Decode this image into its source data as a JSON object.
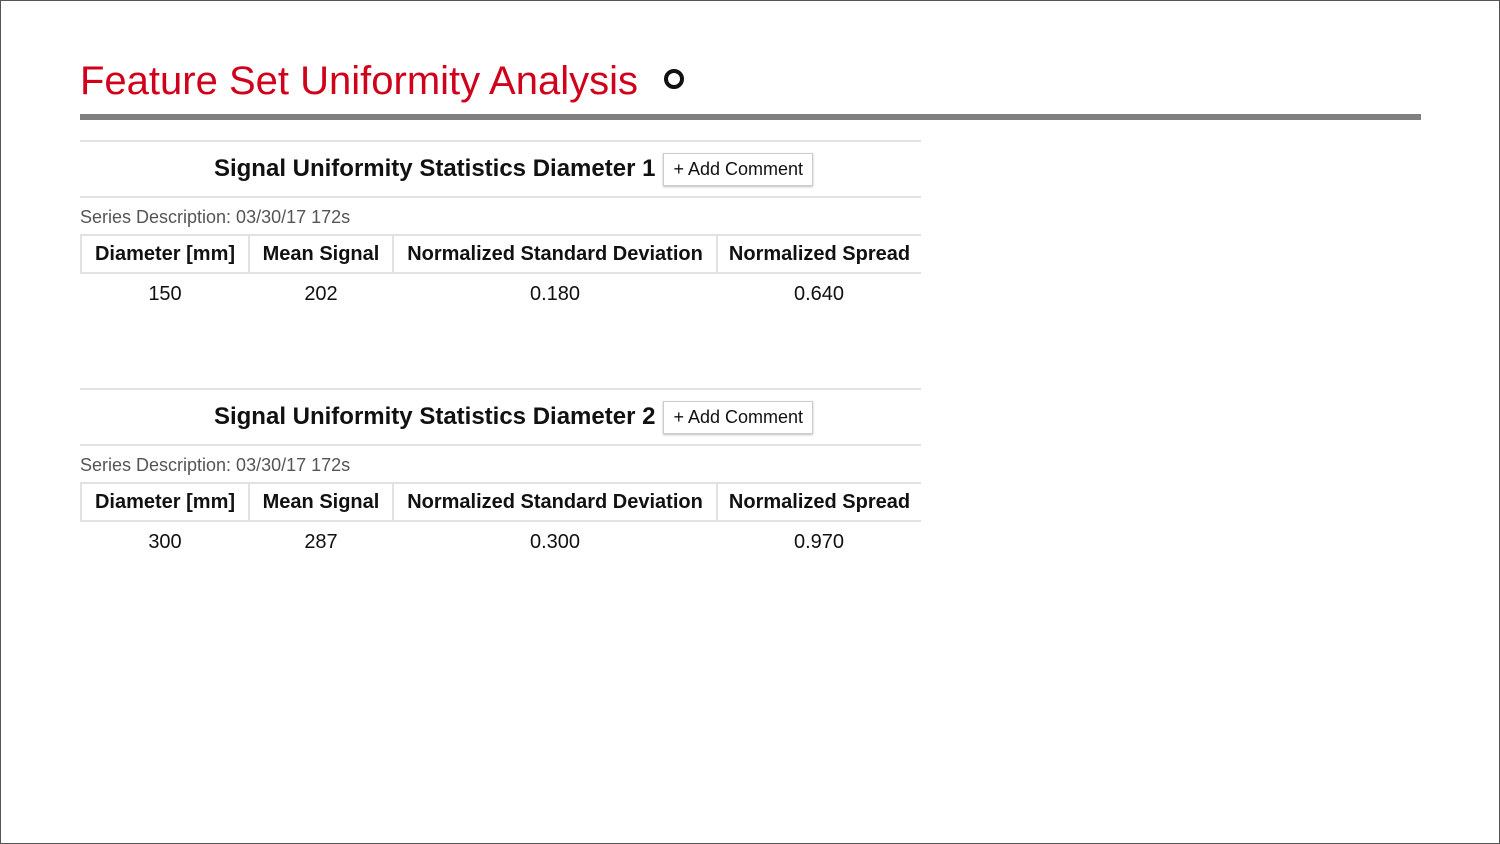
{
  "header": {
    "title": "Feature Set Uniformity Analysis",
    "status_icon": "circle-outline-icon",
    "title_color": "#d0021b"
  },
  "sections": [
    {
      "title": "Signal Uniformity Statistics Diameter 1",
      "add_comment_label": "+ Add Comment",
      "series_description": "Series Description: 03/30/17 172s",
      "columns": [
        "Diameter [mm]",
        "Mean Signal",
        "Normalized Standard Deviation",
        "Normalized Spread"
      ],
      "rows": [
        [
          "150",
          "202",
          "0.180",
          "0.640"
        ]
      ]
    },
    {
      "title": "Signal Uniformity Statistics Diameter 2",
      "add_comment_label": "+ Add Comment",
      "series_description": "Series Description: 03/30/17 172s",
      "columns": [
        "Diameter [mm]",
        "Mean Signal",
        "Normalized Standard Deviation",
        "Normalized Spread"
      ],
      "rows": [
        [
          "300",
          "287",
          "0.300",
          "0.970"
        ]
      ]
    }
  ]
}
